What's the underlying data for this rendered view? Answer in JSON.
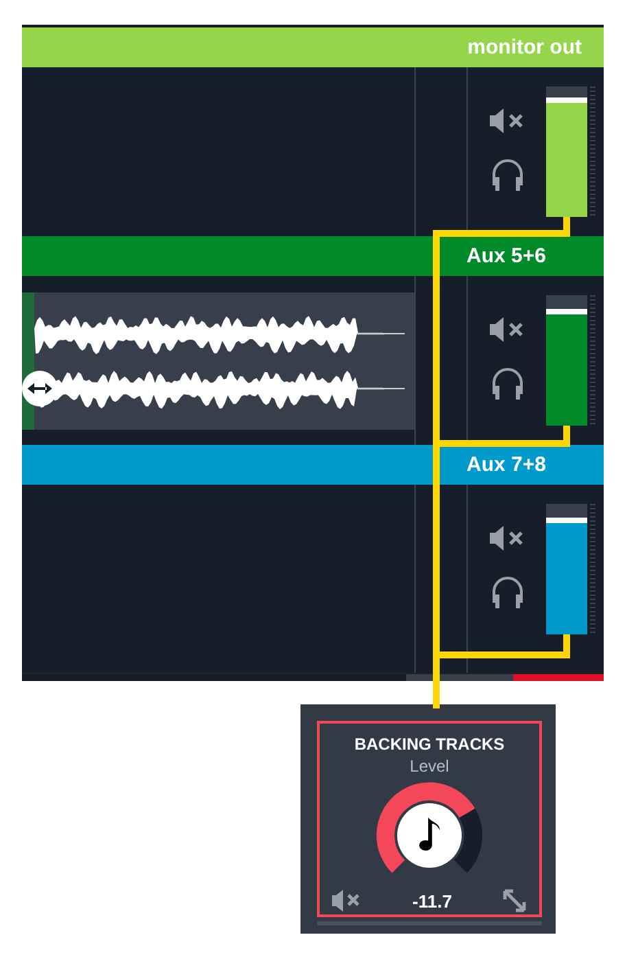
{
  "tracks": [
    {
      "label": "monitor out",
      "color": "#95d549",
      "level": 0.92,
      "waveform": false
    },
    {
      "label": "Aux 5+6",
      "color": "#008a2a",
      "level": 0.9,
      "waveform": true
    },
    {
      "label": "Aux 7+8",
      "color": "#0099cc",
      "level": 0.9,
      "waveform": false
    }
  ],
  "knob": {
    "title": "BACKING TRACKS",
    "subtitle": "Level",
    "value": "-11.7"
  }
}
